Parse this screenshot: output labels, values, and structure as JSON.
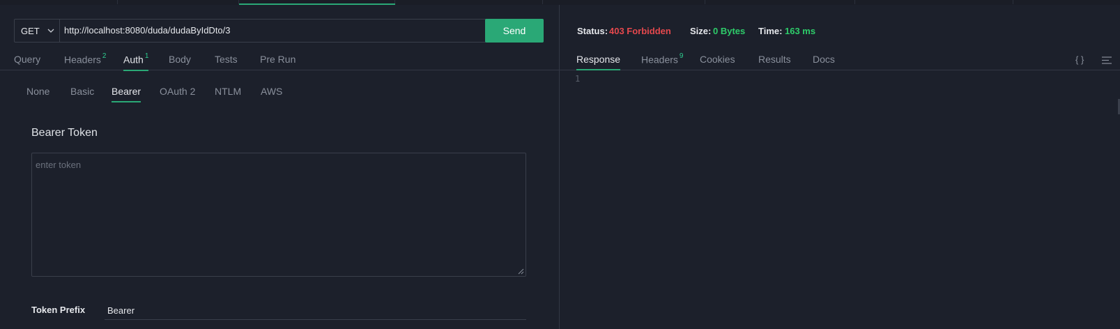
{
  "request": {
    "method": "GET",
    "url": "http://localhost:8080/duda/dudaByIdDto/3",
    "send_label": "Send"
  },
  "request_tabs": [
    {
      "label": "Query",
      "badge": ""
    },
    {
      "label": "Headers",
      "badge": "2"
    },
    {
      "label": "Auth",
      "badge": "1"
    },
    {
      "label": "Body",
      "badge": ""
    },
    {
      "label": "Tests",
      "badge": ""
    },
    {
      "label": "Pre Run",
      "badge": ""
    }
  ],
  "auth_tabs": [
    "None",
    "Basic",
    "Bearer",
    "OAuth 2",
    "NTLM",
    "AWS"
  ],
  "auth": {
    "section_title": "Bearer Token",
    "token_placeholder": "enter token",
    "token_prefix_label": "Token Prefix",
    "token_prefix_value": "Bearer"
  },
  "response": {
    "status_label": "Status:",
    "status_value": "403 Forbidden",
    "size_label": "Size:",
    "size_value": "0 Bytes",
    "time_label": "Time:",
    "time_value": "163 ms",
    "line_number": "1",
    "format_button": "{ }"
  },
  "response_tabs": [
    {
      "label": "Response",
      "badge": ""
    },
    {
      "label": "Headers",
      "badge": "9"
    },
    {
      "label": "Cookies",
      "badge": ""
    },
    {
      "label": "Results",
      "badge": ""
    },
    {
      "label": "Docs",
      "badge": ""
    }
  ],
  "colors": {
    "accent": "#2aa876",
    "error": "#e5484d",
    "success": "#2ecc6a",
    "background": "#1c202b"
  },
  "icons": [
    "chevron-down-icon",
    "resize-grip-icon",
    "menu-lines-icon"
  ]
}
